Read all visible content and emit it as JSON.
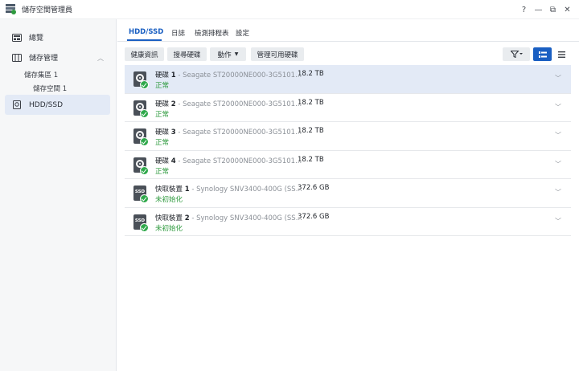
{
  "window": {
    "title": "儲存空間管理員",
    "controls": {
      "help": "?",
      "minimize": "—",
      "maximize": "⧉",
      "close": "✕"
    }
  },
  "sidebar": {
    "items": [
      {
        "label": "總覽",
        "icon": "overview-icon"
      },
      {
        "label": "儲存管理",
        "icon": "storage-icon",
        "expanded": true
      },
      {
        "label": "HDD/SSD",
        "icon": "disk-icon",
        "active": true
      }
    ],
    "sub_items": [
      "儲存集區 1",
      "儲存空間 1"
    ]
  },
  "tabs": [
    "HDD/SSD",
    "日誌",
    "檢測排程表",
    "設定"
  ],
  "active_tab": "HDD/SSD",
  "toolbar": {
    "health": "健康資訊",
    "find": "搜尋硬碟",
    "action": "動作",
    "manage": "管理可用硬碟"
  },
  "colors": {
    "accent": "#1a5fc2",
    "selected_row": "#e3eaf6",
    "status_ok": "#2e9a3e"
  },
  "drives": [
    {
      "name": "硬碟",
      "num": "1",
      "model": "- Seagate ST20000NE000-3G5101...",
      "size": "18.2 TB",
      "status": "正常",
      "type": "hdd"
    },
    {
      "name": "硬碟",
      "num": "2",
      "model": "- Seagate ST20000NE000-3G5101...",
      "size": "18.2 TB",
      "status": "正常",
      "type": "hdd"
    },
    {
      "name": "硬碟",
      "num": "3",
      "model": "- Seagate ST20000NE000-3G5101...",
      "size": "18.2 TB",
      "status": "正常",
      "type": "hdd"
    },
    {
      "name": "硬碟",
      "num": "4",
      "model": "- Seagate ST20000NE000-3G5101...",
      "size": "18.2 TB",
      "status": "正常",
      "type": "hdd"
    },
    {
      "name": "快取裝置",
      "num": "1",
      "model": "- Synology SNV3400-400G (SS...",
      "size": "372.6 GB",
      "status": "未初始化",
      "type": "ssd"
    },
    {
      "name": "快取裝置",
      "num": "2",
      "model": "- Synology SNV3400-400G (SS...",
      "size": "372.6 GB",
      "status": "未初始化",
      "type": "ssd"
    }
  ]
}
